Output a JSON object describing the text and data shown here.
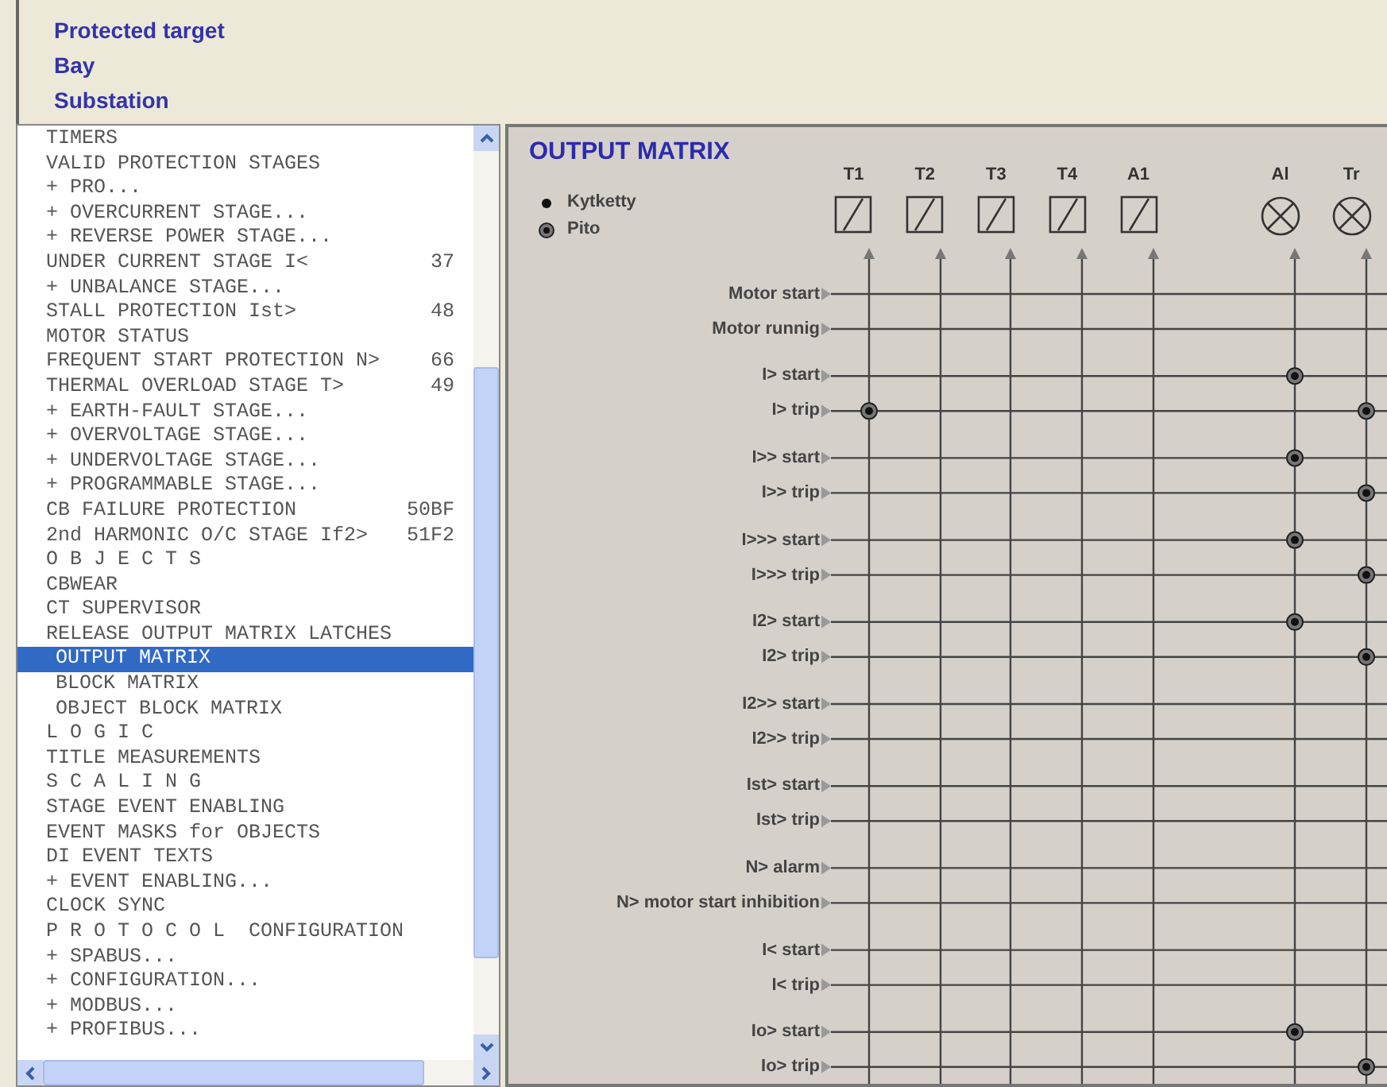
{
  "header": {
    "lines": [
      "Protected target",
      "Bay",
      "Substation"
    ]
  },
  "menu": {
    "items": [
      {
        "text": "TIMERS",
        "kind": "item",
        "selected": false
      },
      {
        "text": "VALID PROTECTION STAGES",
        "kind": "item",
        "selected": false
      },
      {
        "text": "+ PRO...",
        "kind": "item",
        "selected": false
      },
      {
        "text": "+ OVERCURRENT STAGE...",
        "kind": "item",
        "selected": false
      },
      {
        "text": "+ REVERSE POWER STAGE...",
        "kind": "item",
        "selected": false
      },
      {
        "text": "UNDER CURRENT STAGE I<",
        "code": "37",
        "kind": "item",
        "selected": false
      },
      {
        "text": "+ UNBALANCE STAGE...",
        "kind": "item",
        "selected": false
      },
      {
        "text": "STALL PROTECTION Ist>",
        "code": "48",
        "kind": "item",
        "selected": false
      },
      {
        "text": "MOTOR STATUS",
        "kind": "item",
        "selected": false
      },
      {
        "text": "FREQUENT START PROTECTION N>",
        "code": "66",
        "kind": "item",
        "selected": false
      },
      {
        "text": "THERMAL OVERLOAD STAGE T>",
        "code": "49",
        "kind": "item",
        "selected": false
      },
      {
        "text": "+ EARTH-FAULT STAGE...",
        "kind": "item",
        "selected": false
      },
      {
        "text": "+ OVERVOLTAGE STAGE...",
        "kind": "item",
        "selected": false
      },
      {
        "text": "+ UNDERVOLTAGE STAGE...",
        "kind": "item",
        "selected": false
      },
      {
        "text": "+ PROGRAMMABLE STAGE...",
        "kind": "item",
        "selected": false
      },
      {
        "text": "CB FAILURE PROTECTION",
        "code": "50BF",
        "kind": "item",
        "selected": false
      },
      {
        "text": "2nd HARMONIC O/C STAGE If2>",
        "code": "51F2",
        "kind": "item",
        "selected": false
      },
      {
        "text": "O B J E C T S",
        "kind": "item",
        "selected": false
      },
      {
        "text": "CBWEAR",
        "kind": "item",
        "selected": false
      },
      {
        "text": "CT SUPERVISOR",
        "kind": "item",
        "selected": false
      },
      {
        "text": "RELEASE OUTPUT MATRIX LATCHES",
        "kind": "item",
        "selected": false
      },
      {
        "text": "OUTPUT MATRIX",
        "kind": "sub",
        "selected": true
      },
      {
        "text": "BLOCK MATRIX",
        "kind": "sub",
        "selected": false
      },
      {
        "text": "OBJECT BLOCK MATRIX",
        "kind": "sub",
        "selected": false
      },
      {
        "text": "L O G I C",
        "kind": "item",
        "selected": false
      },
      {
        "text": "TITLE MEASUREMENTS",
        "kind": "item",
        "selected": false
      },
      {
        "text": "S C A L I N G",
        "kind": "item",
        "selected": false
      },
      {
        "text": "STAGE EVENT ENABLING",
        "kind": "item",
        "selected": false
      },
      {
        "text": "EVENT MASKS for OBJECTS",
        "kind": "item",
        "selected": false
      },
      {
        "text": "DI EVENT TEXTS",
        "kind": "item",
        "selected": false
      },
      {
        "text": "+ EVENT ENABLING...",
        "kind": "item",
        "selected": false
      },
      {
        "text": "CLOCK SYNC",
        "kind": "item",
        "selected": false
      },
      {
        "text": "P R O T O C O L  CONFIGURATION",
        "kind": "item",
        "selected": false
      },
      {
        "text": "+ SPABUS...",
        "kind": "item",
        "selected": false
      },
      {
        "text": "+ CONFIGURATION...",
        "kind": "item",
        "selected": false
      },
      {
        "text": "+ MODBUS...",
        "kind": "item",
        "selected": false
      },
      {
        "text": "+ PROFIBUS...",
        "kind": "item",
        "selected": false
      }
    ]
  },
  "matrix": {
    "title": "OUTPUT MATRIX",
    "legend": [
      {
        "kind": "connected",
        "label": "Kytketty"
      },
      {
        "kind": "latched",
        "label": "Pito"
      }
    ],
    "columns": [
      {
        "label": "T1",
        "kind": "relay"
      },
      {
        "label": "T2",
        "kind": "relay"
      },
      {
        "label": "T3",
        "kind": "relay"
      },
      {
        "label": "T4",
        "kind": "relay"
      },
      {
        "label": "A1",
        "kind": "relay"
      },
      {
        "label": "Al",
        "kind": "lamp"
      },
      {
        "label": "Tr",
        "kind": "lamp"
      }
    ],
    "rows": [
      {
        "label": "Motor start",
        "cells": [
          {
            "kind": "none"
          },
          {
            "kind": "none"
          },
          {
            "kind": "none"
          },
          {
            "kind": "none"
          },
          {
            "kind": "none"
          },
          {
            "kind": "none"
          },
          {
            "kind": "none"
          }
        ]
      },
      {
        "label": "Motor runnig",
        "cells": [
          {
            "kind": "none"
          },
          {
            "kind": "none"
          },
          {
            "kind": "none"
          },
          {
            "kind": "none"
          },
          {
            "kind": "none"
          },
          {
            "kind": "none"
          },
          {
            "kind": "none"
          }
        ]
      },
      {
        "label": "I> start",
        "cells": [
          {
            "kind": "none"
          },
          {
            "kind": "none"
          },
          {
            "kind": "none"
          },
          {
            "kind": "none"
          },
          {
            "kind": "none"
          },
          {
            "kind": "latched"
          },
          {
            "kind": "none"
          }
        ]
      },
      {
        "label": "I> trip",
        "cells": [
          {
            "kind": "latched"
          },
          {
            "kind": "none"
          },
          {
            "kind": "none"
          },
          {
            "kind": "none"
          },
          {
            "kind": "none"
          },
          {
            "kind": "none"
          },
          {
            "kind": "latched"
          }
        ]
      },
      {
        "label": "I>> start",
        "cells": [
          {
            "kind": "none"
          },
          {
            "kind": "none"
          },
          {
            "kind": "none"
          },
          {
            "kind": "none"
          },
          {
            "kind": "none"
          },
          {
            "kind": "latched"
          },
          {
            "kind": "none"
          }
        ]
      },
      {
        "label": "I>> trip",
        "cells": [
          {
            "kind": "none"
          },
          {
            "kind": "none"
          },
          {
            "kind": "none"
          },
          {
            "kind": "none"
          },
          {
            "kind": "none"
          },
          {
            "kind": "none"
          },
          {
            "kind": "latched"
          }
        ]
      },
      {
        "label": "I>>> start",
        "cells": [
          {
            "kind": "none"
          },
          {
            "kind": "none"
          },
          {
            "kind": "none"
          },
          {
            "kind": "none"
          },
          {
            "kind": "none"
          },
          {
            "kind": "latched"
          },
          {
            "kind": "none"
          }
        ]
      },
      {
        "label": "I>>> trip",
        "cells": [
          {
            "kind": "none"
          },
          {
            "kind": "none"
          },
          {
            "kind": "none"
          },
          {
            "kind": "none"
          },
          {
            "kind": "none"
          },
          {
            "kind": "none"
          },
          {
            "kind": "latched"
          }
        ]
      },
      {
        "label": "I2> start",
        "cells": [
          {
            "kind": "none"
          },
          {
            "kind": "none"
          },
          {
            "kind": "none"
          },
          {
            "kind": "none"
          },
          {
            "kind": "none"
          },
          {
            "kind": "latched"
          },
          {
            "kind": "none"
          }
        ]
      },
      {
        "label": "I2> trip",
        "cells": [
          {
            "kind": "none"
          },
          {
            "kind": "none"
          },
          {
            "kind": "none"
          },
          {
            "kind": "none"
          },
          {
            "kind": "none"
          },
          {
            "kind": "none"
          },
          {
            "kind": "latched"
          }
        ]
      },
      {
        "label": "I2>> start",
        "cells": [
          {
            "kind": "none"
          },
          {
            "kind": "none"
          },
          {
            "kind": "none"
          },
          {
            "kind": "none"
          },
          {
            "kind": "none"
          },
          {
            "kind": "none"
          },
          {
            "kind": "none"
          }
        ]
      },
      {
        "label": "I2>> trip",
        "cells": [
          {
            "kind": "none"
          },
          {
            "kind": "none"
          },
          {
            "kind": "none"
          },
          {
            "kind": "none"
          },
          {
            "kind": "none"
          },
          {
            "kind": "none"
          },
          {
            "kind": "none"
          }
        ]
      },
      {
        "label": "Ist> start",
        "cells": [
          {
            "kind": "none"
          },
          {
            "kind": "none"
          },
          {
            "kind": "none"
          },
          {
            "kind": "none"
          },
          {
            "kind": "none"
          },
          {
            "kind": "none"
          },
          {
            "kind": "none"
          }
        ]
      },
      {
        "label": "Ist> trip",
        "cells": [
          {
            "kind": "none"
          },
          {
            "kind": "none"
          },
          {
            "kind": "none"
          },
          {
            "kind": "none"
          },
          {
            "kind": "none"
          },
          {
            "kind": "none"
          },
          {
            "kind": "none"
          }
        ]
      },
      {
        "label": "N> alarm",
        "cells": [
          {
            "kind": "none"
          },
          {
            "kind": "none"
          },
          {
            "kind": "none"
          },
          {
            "kind": "none"
          },
          {
            "kind": "none"
          },
          {
            "kind": "none"
          },
          {
            "kind": "none"
          }
        ]
      },
      {
        "label": "N> motor start inhibition",
        "cells": [
          {
            "kind": "none"
          },
          {
            "kind": "none"
          },
          {
            "kind": "none"
          },
          {
            "kind": "none"
          },
          {
            "kind": "none"
          },
          {
            "kind": "none"
          },
          {
            "kind": "none"
          }
        ]
      },
      {
        "label": "I< start",
        "cells": [
          {
            "kind": "none"
          },
          {
            "kind": "none"
          },
          {
            "kind": "none"
          },
          {
            "kind": "none"
          },
          {
            "kind": "none"
          },
          {
            "kind": "none"
          },
          {
            "kind": "none"
          }
        ]
      },
      {
        "label": "I< trip",
        "cells": [
          {
            "kind": "none"
          },
          {
            "kind": "none"
          },
          {
            "kind": "none"
          },
          {
            "kind": "none"
          },
          {
            "kind": "none"
          },
          {
            "kind": "none"
          },
          {
            "kind": "none"
          }
        ]
      },
      {
        "label": "Io> start",
        "cells": [
          {
            "kind": "none"
          },
          {
            "kind": "none"
          },
          {
            "kind": "none"
          },
          {
            "kind": "none"
          },
          {
            "kind": "none"
          },
          {
            "kind": "latched"
          },
          {
            "kind": "none"
          }
        ]
      },
      {
        "label": "Io> trip",
        "cells": [
          {
            "kind": "none"
          },
          {
            "kind": "none"
          },
          {
            "kind": "none"
          },
          {
            "kind": "none"
          },
          {
            "kind": "none"
          },
          {
            "kind": "none"
          },
          {
            "kind": "latched"
          }
        ]
      }
    ]
  }
}
